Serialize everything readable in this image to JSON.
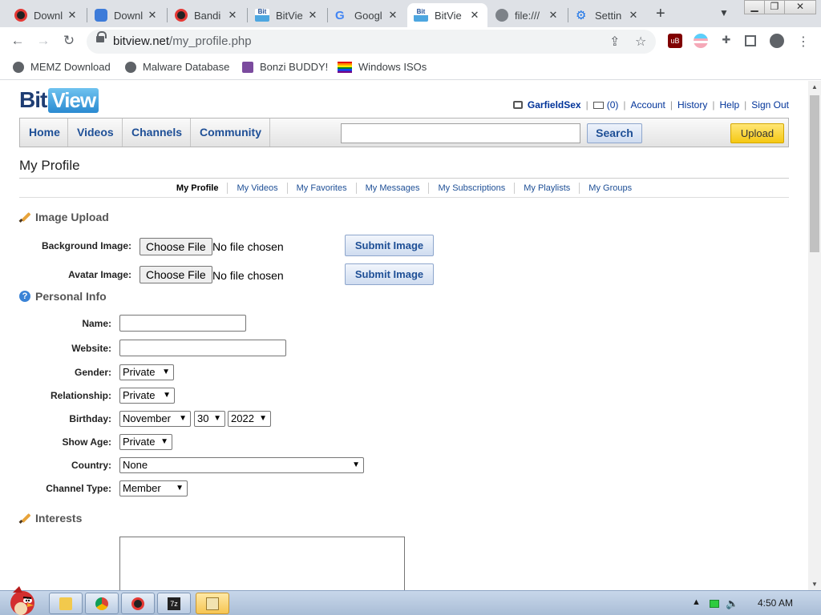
{
  "browser": {
    "tabs": [
      {
        "title": "Downl",
        "icon": "record-icon",
        "active": false
      },
      {
        "title": "Downl",
        "icon": "bandicam-icon",
        "active": false
      },
      {
        "title": "Bandi",
        "icon": "record-icon",
        "active": false
      },
      {
        "title": "BitVie",
        "icon": "bitview-icon",
        "active": false
      },
      {
        "title": "Googl",
        "icon": "google-icon",
        "active": false
      },
      {
        "title": "BitVie",
        "icon": "bitview-icon",
        "active": true
      },
      {
        "title": "file:///",
        "icon": "globe-icon",
        "active": false
      },
      {
        "title": "Settin",
        "icon": "gear-icon",
        "active": false
      }
    ],
    "tab_close": "✕",
    "new_tab": "+",
    "url_host": "bitview.net",
    "url_path": "/my_profile.php",
    "bookmarks": [
      {
        "label": "MEMZ Download",
        "icon": "globe-icon"
      },
      {
        "label": "Malware Database",
        "icon": "globe-icon"
      },
      {
        "label": "Bonzi BUDDY!",
        "icon": "bonzi-icon"
      },
      {
        "label": "Windows ISOs",
        "icon": "rainbow-flag-icon"
      }
    ]
  },
  "site": {
    "logo_bit": "Bit",
    "logo_view": "View",
    "user": {
      "username": "GarfieldSex",
      "messages": "(0)",
      "links": [
        "Account",
        "History",
        "Help",
        "Sign Out"
      ]
    },
    "nav": [
      "Home",
      "Videos",
      "Channels",
      "Community"
    ],
    "search_button": "Search",
    "upload_button": "Upload",
    "page_title": "My Profile",
    "subnav": [
      {
        "label": "My Profile",
        "current": true
      },
      {
        "label": "My Videos",
        "current": false
      },
      {
        "label": "My Favorites",
        "current": false
      },
      {
        "label": "My Messages",
        "current": false
      },
      {
        "label": "My Subscriptions",
        "current": false
      },
      {
        "label": "My Playlists",
        "current": false
      },
      {
        "label": "My Groups",
        "current": false
      }
    ]
  },
  "image_upload": {
    "heading": "Image Upload",
    "background_label": "Background Image:",
    "avatar_label": "Avatar Image:",
    "choose_file": "Choose File",
    "no_file": "No file chosen",
    "submit": "Submit Image"
  },
  "personal_info": {
    "heading": "Personal Info",
    "name_label": "Name:",
    "website_label": "Website:",
    "gender_label": "Gender:",
    "gender_value": "Private",
    "relationship_label": "Relationship:",
    "relationship_value": "Private",
    "birthday_label": "Birthday:",
    "birthday_month": "November",
    "birthday_day": "30",
    "birthday_year": "2022",
    "show_age_label": "Show Age:",
    "show_age_value": "Private",
    "country_label": "Country:",
    "country_value": "None",
    "channel_type_label": "Channel Type:",
    "channel_type_value": "Member"
  },
  "interests": {
    "heading": "Interests"
  },
  "taskbar": {
    "time": "4:50 AM"
  }
}
